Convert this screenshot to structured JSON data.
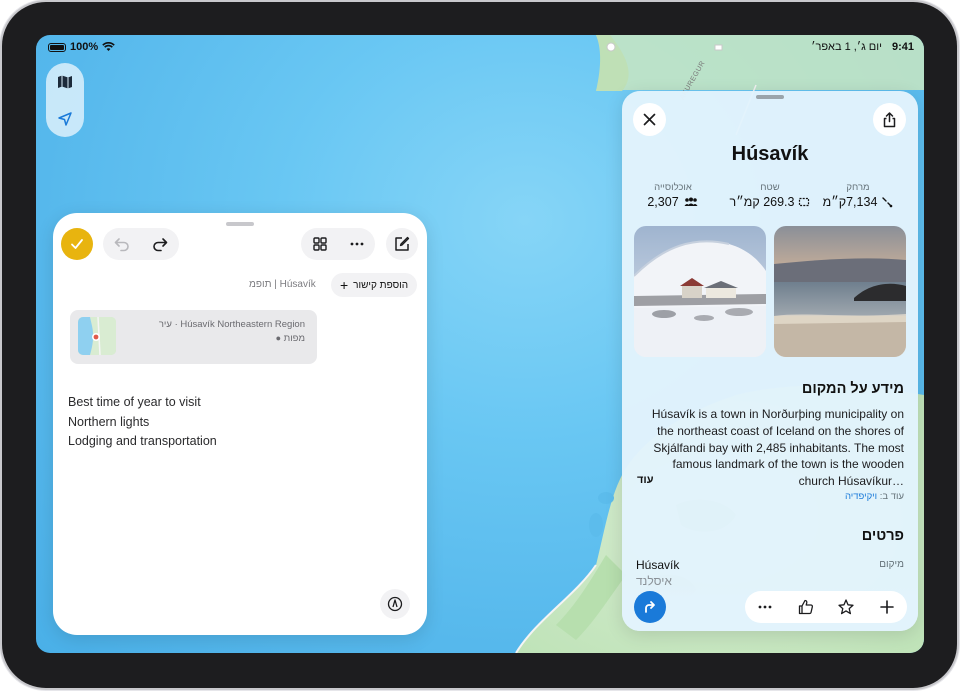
{
  "status_bar": {
    "battery": "100%",
    "time": "9:41",
    "date": "יום ג׳, 1 באפר׳"
  },
  "map": {
    "road_label": "AKUREGUR",
    "controls": [
      {
        "icon": "map-icon"
      },
      {
        "icon": "location-arrow-icon"
      }
    ]
  },
  "note": {
    "add_link_label": "הוספת קישור",
    "breadcrumb": "Húsavík | תופמ",
    "link_card": {
      "title": "Húsavík Northeastern Region · עיר",
      "source": "מפות"
    },
    "lines": [
      "Best time of year to visit",
      "Northern lights",
      "Lodging and transportation"
    ],
    "accent_color": "#e8b40f"
  },
  "place": {
    "title": "Húsavík",
    "stats": [
      {
        "label": "מרחק",
        "value": "7,134ק״מ",
        "icon": "distance-icon"
      },
      {
        "label": "שטח",
        "value": "269.3 קמ״ר",
        "icon": "area-icon"
      },
      {
        "label": "אוכלוסייה",
        "value": "2,307",
        "icon": "people-icon"
      }
    ],
    "about_heading": "מידע על המקום",
    "about_text": "Húsavík is a town in Norðurþing municipality on the northeast coast of Iceland on the shores of Skjálfandi bay with 2,485 inhabitants. The most famous landmark of the town is the wooden church Húsavíkur…",
    "more_label": "עוד",
    "source_prefix": "עוד ב:",
    "source_name": "ויקיפדיה",
    "details_heading": "פרטים",
    "details": {
      "location_label": "מיקום",
      "location_value": "Húsavík",
      "location_country": "איסלנד"
    },
    "link_color": "#1a7ad9"
  }
}
